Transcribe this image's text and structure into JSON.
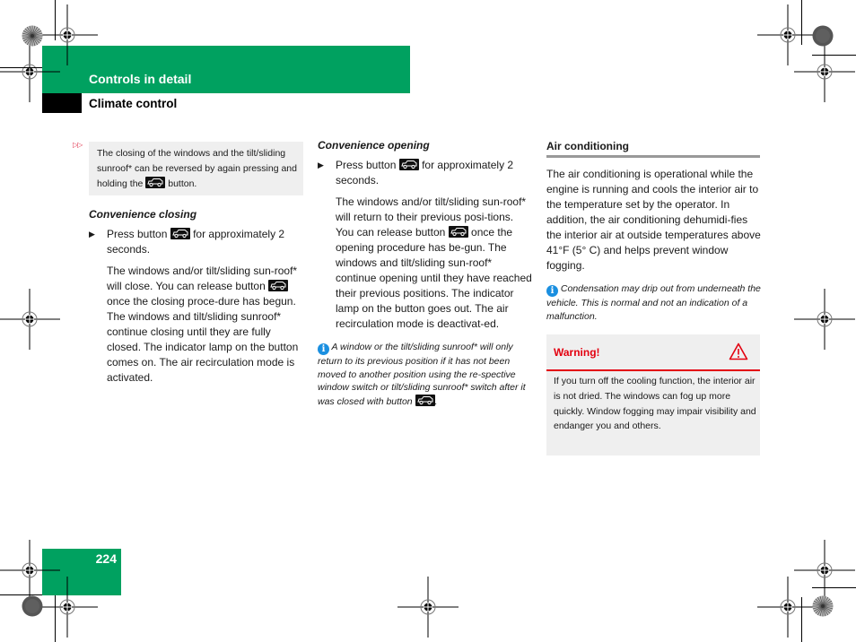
{
  "header": {
    "section_title": "Controls in detail",
    "subsection_title": "Climate control",
    "brand_color": "#00a160"
  },
  "page": {
    "number": "224"
  },
  "column1": {
    "continued_marker": "▷▷",
    "note_box": {
      "text_before_icon": "The closing of the windows and the tilt/sliding sunroof* can be reversed by again pressing and holding the",
      "icon": "convenience-button-icon",
      "text_after_icon": "button."
    },
    "heading": "Convenience closing",
    "step": {
      "bullet": "▶",
      "text_before_icon": "Press button",
      "icon": "convenience-button-icon",
      "text_after_icon": "for approximately 2 seconds."
    },
    "paragraph": {
      "text_before_icon": "The windows and/or tilt/sliding sun-roof* will close. You can release button",
      "icon": "convenience-button-icon",
      "text_after_icon": "once the closing proce-dure has begun. The windows and tilt/sliding sunroof* continue closing until they are fully closed. The indicator lamp on the button comes on. The air recirculation mode is activated."
    }
  },
  "column2": {
    "heading": "Convenience opening",
    "step": {
      "bullet": "▶",
      "text_before_icon": "Press button",
      "icon": "convenience-button-icon",
      "text_after_icon": "for approximately 2 seconds."
    },
    "paragraph": {
      "text_before_icon": "The windows and/or tilt/sliding sun-roof* will return to their previous posi-tions. You can release button",
      "icon": "convenience-button-icon",
      "text_after_icon": "once the opening procedure has be-gun. The windows and tilt/sliding sun-roof* continue opening until they have reached their previous positions. The indicator lamp on the button goes out. The air recirculation mode is deactivat-ed."
    },
    "info": {
      "icon": "info-icon",
      "icon_glyph": "i",
      "text_before_icon": "A window or the tilt/sliding sunroof* will only return to its previous position if it has not been moved to another position using the re-spective window switch or tilt/sliding sunroof* switch after it was closed with button",
      "button_icon": "convenience-button-icon",
      "text_after_icon": "."
    }
  },
  "column3": {
    "heading": "Air conditioning",
    "paragraph": "The air conditioning is operational while the engine is running and cools the interior air to the temperature set by the operator. In addition, the air conditioning dehumidi-fies the interior air at outside temperatures above 41°F (5° C) and helps prevent window fogging.",
    "info": {
      "icon": "info-icon",
      "icon_glyph": "i",
      "text": "Condensation may drip out from underneath the vehicle. This is normal and not an indication of a malfunction."
    },
    "warning": {
      "title": "Warning!",
      "icon": "warning-triangle-icon",
      "text": "If you turn off the cooling function, the interior air is not dried. The windows can fog up more quickly. Window fogging may impair visibility and endanger you and others.",
      "color": "#e3000f"
    }
  }
}
